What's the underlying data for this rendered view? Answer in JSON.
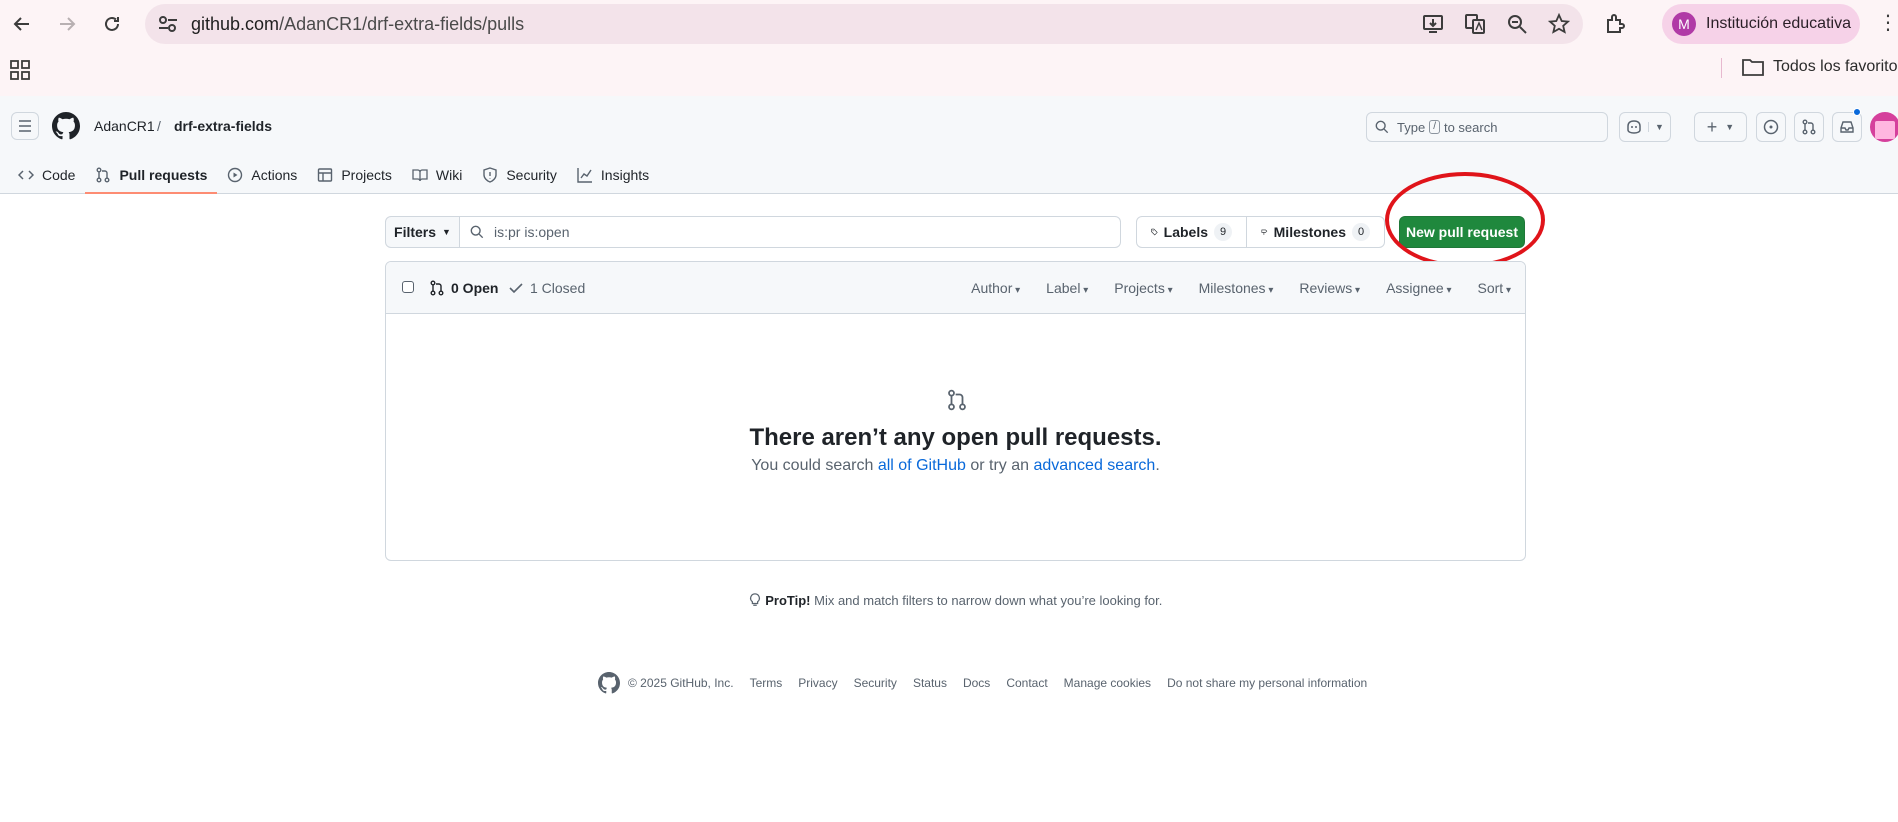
{
  "browser": {
    "url_host": "github.com",
    "url_path": "/AdanCR1/drf-extra-fields/pulls",
    "profile_initial": "M",
    "profile_name": "Institución educativa",
    "bookmarks_folder": "Todos los favoritos"
  },
  "header": {
    "owner": "AdanCR1",
    "separator": "/",
    "repo": "drf-extra-fields",
    "search_prefix": "Type",
    "search_key": "/",
    "search_suffix": "to search"
  },
  "nav": {
    "tabs": [
      {
        "label": "Code",
        "icon": "code-icon"
      },
      {
        "label": "Pull requests",
        "icon": "git-pull-request-icon",
        "selected": true
      },
      {
        "label": "Actions",
        "icon": "play-icon"
      },
      {
        "label": "Projects",
        "icon": "table-icon"
      },
      {
        "label": "Wiki",
        "icon": "book-icon"
      },
      {
        "label": "Security",
        "icon": "shield-icon"
      },
      {
        "label": "Insights",
        "icon": "graph-icon"
      }
    ]
  },
  "filters": {
    "button_label": "Filters",
    "query": "is:pr is:open",
    "labels_label": "Labels",
    "labels_count": "9",
    "milestones_label": "Milestones",
    "milestones_count": "0",
    "new_pr_label": "New pull request"
  },
  "list": {
    "open_label": "0 Open",
    "closed_label": "1 Closed",
    "sort_menus": [
      "Author",
      "Label",
      "Projects",
      "Milestones",
      "Reviews",
      "Assignee",
      "Sort"
    ],
    "empty_title": "There aren’t any open pull requests.",
    "empty_text_1": "You could search ",
    "empty_link_1": "all of GitHub",
    "empty_text_2": " or try an ",
    "empty_link_2": "advanced search",
    "empty_text_3": "."
  },
  "protip": {
    "bold": "ProTip!",
    "text": " Mix and match filters to narrow down what you’re looking for."
  },
  "footer": {
    "copyright": "© 2025 GitHub, Inc.",
    "links": [
      "Terms",
      "Privacy",
      "Security",
      "Status",
      "Docs",
      "Contact",
      "Manage cookies",
      "Do not share my personal information"
    ]
  },
  "colors": {
    "accent_green": "#1f883d",
    "link_blue": "#0969da",
    "tab_underline": "#fd8c73",
    "annotation_red": "#e0141a"
  }
}
